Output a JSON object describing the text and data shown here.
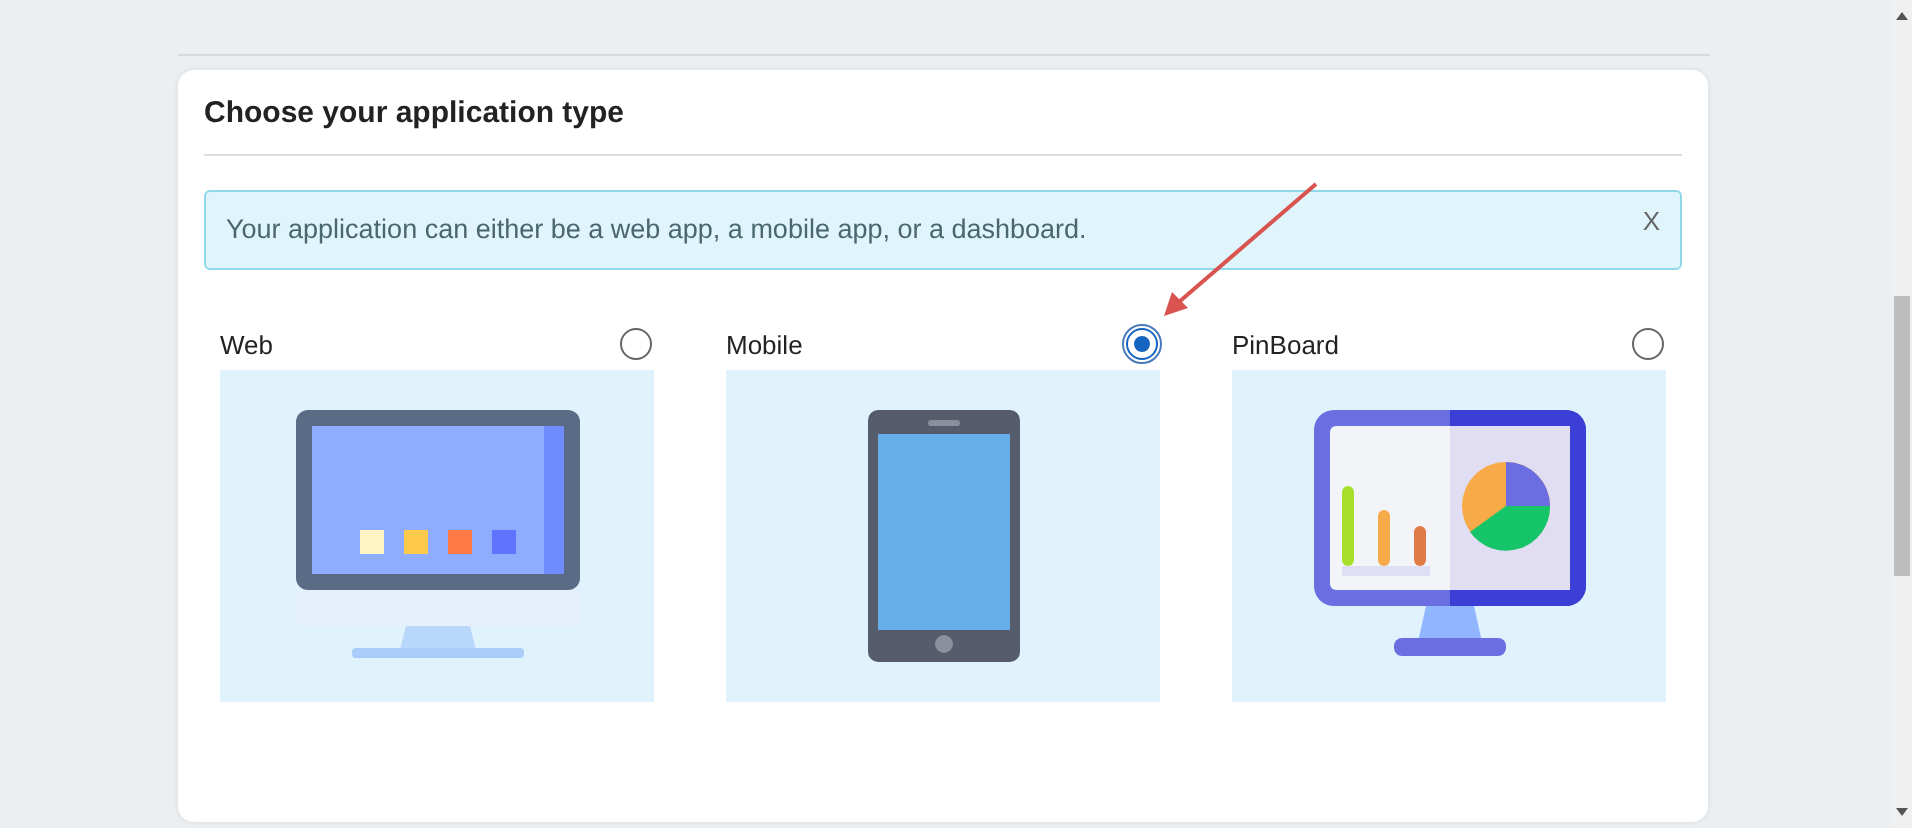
{
  "card": {
    "title": "Choose your application type"
  },
  "alert": {
    "text": "Your application can either be a web app, a mobile app, or a dashboard.",
    "close": "X"
  },
  "options": [
    {
      "label": "Web",
      "selected": false,
      "kind": "desktop"
    },
    {
      "label": "Mobile",
      "selected": true,
      "kind": "phone"
    },
    {
      "label": "PinBoard",
      "selected": false,
      "kind": "dashboard"
    }
  ]
}
